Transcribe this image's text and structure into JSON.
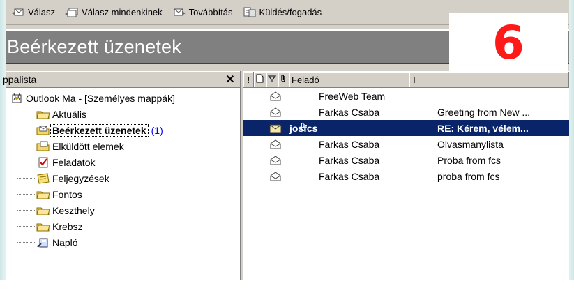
{
  "toolbar": {
    "reply": "Válasz",
    "reply_all": "Válasz mindenkinek",
    "forward": "Továbbítás",
    "send_receive": "Küldés/fogadás"
  },
  "window": {
    "title": "Beérkezett üzenetek"
  },
  "overlay_number": "6",
  "folder_pane": {
    "header": "ppalista",
    "root": "Outlook Ma - [Személyes mappák]",
    "folders": [
      {
        "label": "Aktuális",
        "icon": "folder-icon"
      },
      {
        "label": "Beérkezett üzenetek",
        "count": "(1)",
        "icon": "inbox-icon",
        "selected": true
      },
      {
        "label": "Elküldött elemek",
        "icon": "sent-folder-icon"
      },
      {
        "label": "Feladatok",
        "icon": "tasks-icon"
      },
      {
        "label": "Feljegyzések",
        "icon": "notes-icon"
      },
      {
        "label": "Fontos",
        "icon": "folder-icon"
      },
      {
        "label": "Keszthely",
        "icon": "folder-icon"
      },
      {
        "label": "Krebsz",
        "icon": "folder-icon"
      },
      {
        "label": "Napló",
        "icon": "journal-icon"
      }
    ]
  },
  "message_list": {
    "columns": {
      "importance": "!",
      "from": "Feladó",
      "subject": "T"
    },
    "rows": [
      {
        "from": "FreeWeb Team",
        "subject": "",
        "read": true,
        "attachment": false
      },
      {
        "from": "Farkas Csaba",
        "subject": "Greeting from New ...",
        "read": true,
        "attachment": false
      },
      {
        "from": "josfcs",
        "subject": "RE: Kérem, vélem...",
        "read": false,
        "attachment": true,
        "selected": true
      },
      {
        "from": "Farkas Csaba",
        "subject": "Olvasmanylista",
        "read": true,
        "attachment": false
      },
      {
        "from": "Farkas Csaba",
        "subject": "Proba from fcs",
        "read": true,
        "attachment": false
      },
      {
        "from": "Farkas Csaba",
        "subject": "proba from fcs",
        "read": true,
        "attachment": false
      }
    ]
  },
  "colors": {
    "title_bg": "#808080",
    "selection": "#0a246a",
    "overlay_number": "#ff1a1a",
    "unread_count": "#0000ff"
  }
}
